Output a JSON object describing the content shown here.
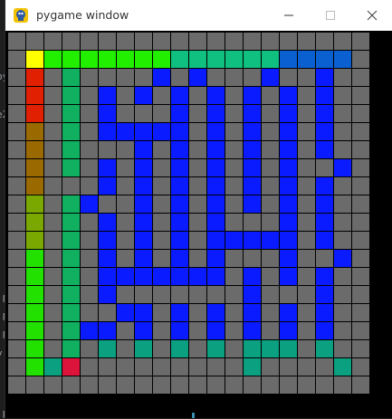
{
  "window": {
    "title": "pygame window",
    "icon": "pygame-snake-icon",
    "controls": [
      "minimize-icon",
      "maximize-icon",
      "close-icon"
    ]
  },
  "background_fragments": [
    "py",
    "e2",
    ".py",
    ".py",
    ".py",
    "y",
    ".py"
  ],
  "maze": {
    "rows": 20,
    "cols": 20,
    "wall_color": "#6b6b6b",
    "start_color": "#ffff00",
    "goal_color": "#dc143c",
    "visited_color": "#0a1cff",
    "start": [
      1,
      1
    ],
    "goal": [
      19,
      3
    ],
    "grid": [
      "####################",
      "#S.................#",
      "#.#................#",
      "#.#................#",
      "#.#................#",
      "#.#................#",
      "#.#................#",
      "#.#................#",
      "#.#................#",
      "#.#................#",
      "#.#................#",
      "#.#................#",
      "#.#................#",
      "#.#................#",
      "#.#................#",
      "#.#................#",
      "#.#................#",
      "#.#................#",
      "#..G...............#",
      "####################"
    ]
  }
}
